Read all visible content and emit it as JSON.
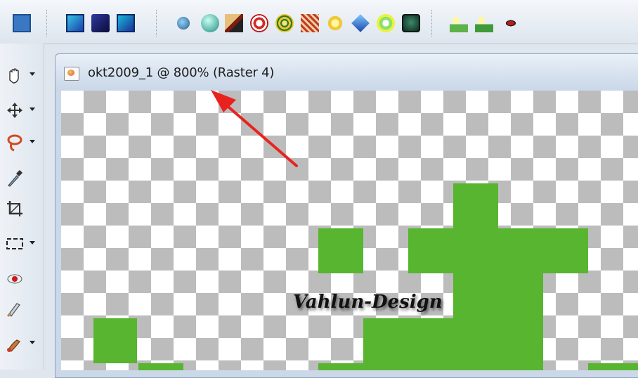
{
  "document": {
    "title": "okt2009_1 @ 800% (Raster 4)"
  },
  "canvas": {
    "watermark_text": "Vahlun-Design",
    "pixel_color": "#57b52f",
    "checker_light": "#ffffff",
    "checker_dark": "#bcbcbc"
  },
  "annotation": {
    "arrow_color": "#e8231f"
  },
  "toolbar": {
    "buttons": [
      "layer-palette-icon",
      "mask-icon",
      "gradient-cube-icon",
      "selection-box-icon",
      "sphere-icon",
      "globe-icon",
      "bevel-icon",
      "swirl-icon",
      "target-icon",
      "texture-icon",
      "star-burst-icon",
      "gem-icon",
      "sunburst-icon",
      "frame-icon",
      "sparkle-tool-icon",
      "sparkle-tool-2-icon",
      "red-eye-icon"
    ]
  },
  "tools": [
    "pan-tool-icon",
    "move-tool-icon",
    "lasso-tool-icon",
    "dropper-tool-icon",
    "crop-tool-icon",
    "selection-tool-icon",
    "red-eye-tool-icon",
    "brush-tool-icon",
    "paint-tool-icon"
  ]
}
